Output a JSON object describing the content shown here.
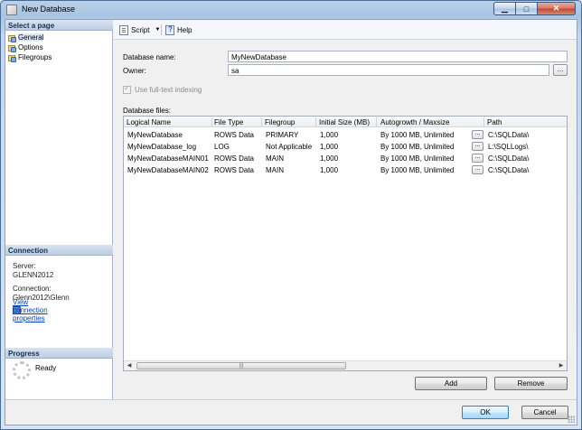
{
  "window": {
    "title": "New Database"
  },
  "left_pane": {
    "select_page_header": "Select a page",
    "pages": [
      {
        "label": "General"
      },
      {
        "label": "Options"
      },
      {
        "label": "Filegroups"
      }
    ],
    "connection_header": "Connection",
    "server_label": "Server:",
    "server_value": "GLENN2012",
    "connection_label": "Connection:",
    "connection_value": "Glenn2012\\Glenn",
    "view_connection_link": "View connection properties",
    "progress_header": "Progress",
    "progress_status": "Ready"
  },
  "toolbar": {
    "script_label": "Script",
    "help_label": "Help"
  },
  "form": {
    "db_name_label": "Database name:",
    "db_name_value": "MyNewDatabase",
    "owner_label": "Owner:",
    "owner_value": "sa",
    "fulltext_label": "Use full-text indexing",
    "db_files_label": "Database files:"
  },
  "grid": {
    "columns": [
      "Logical Name",
      "File Type",
      "Filegroup",
      "Initial Size (MB)",
      "Autogrowth / Maxsize",
      "Path"
    ],
    "rows": [
      {
        "name": "MyNewDatabase",
        "type": "ROWS Data",
        "filegroup": "PRIMARY",
        "size": "1,000",
        "growth": "By 1000 MB, Unlimited",
        "path": "C:\\SQLData\\"
      },
      {
        "name": "MyNewDatabase_log",
        "type": "LOG",
        "filegroup": "Not Applicable",
        "size": "1,000",
        "growth": "By 1000 MB, Unlimited",
        "path": "L:\\SQLLogs\\"
      },
      {
        "name": "MyNewDatabaseMAIN01",
        "type": "ROWS Data",
        "filegroup": "MAIN",
        "size": "1,000",
        "growth": "By 1000 MB, Unlimited",
        "path": "C:\\SQLData\\"
      },
      {
        "name": "MyNewDatabaseMAIN02",
        "type": "ROWS Data",
        "filegroup": "MAIN",
        "size": "1,000",
        "growth": "By 1000 MB, Unlimited",
        "path": "C:\\SQLData\\"
      }
    ],
    "cell_button_label": "...",
    "scroll_thumb_grip": "|||"
  },
  "buttons": {
    "add": "Add",
    "remove": "Remove",
    "ok": "OK",
    "cancel": "Cancel",
    "ellipsis": "..."
  },
  "colors": {
    "link": "#0645ad",
    "accent": "#3c7fb1"
  }
}
